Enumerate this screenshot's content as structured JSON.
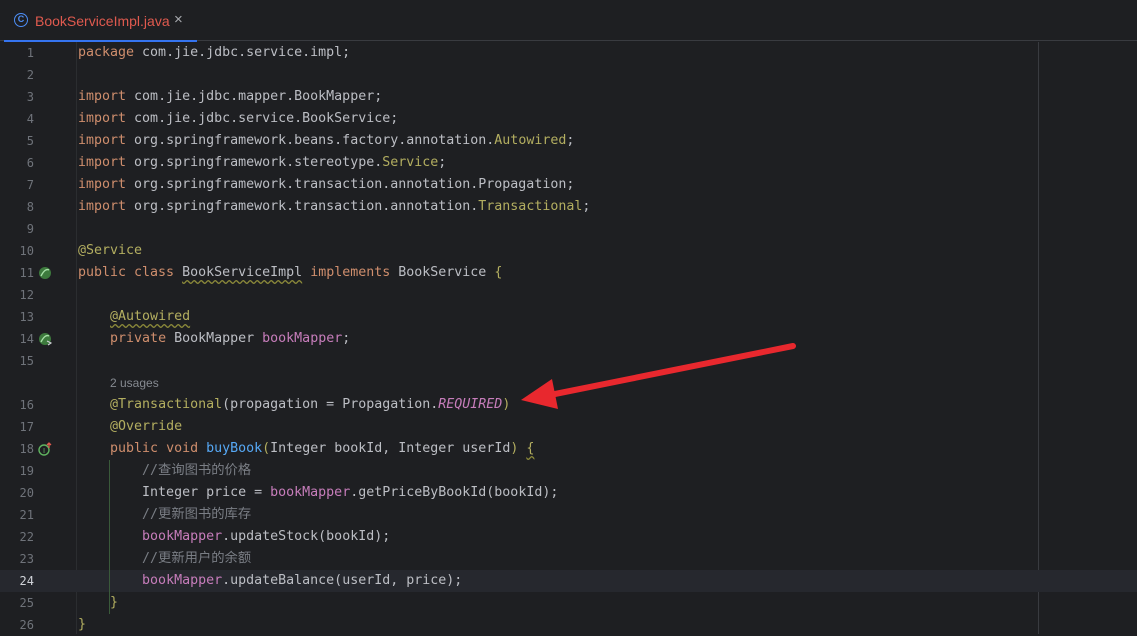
{
  "tab": {
    "icon": "class-c-icon",
    "label": "BookServiceImpl.java",
    "close": "×"
  },
  "editor": {
    "current_line": "24",
    "hint": "2 usages",
    "lines": [
      {
        "n": "1",
        "parts": [
          [
            "kw",
            "package"
          ],
          [
            "",
            "com.jie.jdbc.service.impl;"
          ]
        ]
      },
      {
        "n": "2",
        "parts": []
      },
      {
        "n": "3",
        "parts": [
          [
            "kw",
            "import"
          ],
          [
            "",
            "com.jie.jdbc.mapper.BookMapper;"
          ]
        ]
      },
      {
        "n": "4",
        "parts": [
          [
            "kw",
            "import"
          ],
          [
            "",
            "com.jie.jdbc.service.BookService;"
          ]
        ]
      },
      {
        "n": "5",
        "parts": [
          [
            "kw",
            "import"
          ],
          [
            "",
            "org.springframework.beans.factory.annotation."
          ],
          [
            "ann",
            "Autowired"
          ],
          [
            "",
            ";"
          ]
        ]
      },
      {
        "n": "6",
        "parts": [
          [
            "kw",
            "import"
          ],
          [
            "",
            "org.springframework.stereotype."
          ],
          [
            "ann",
            "Service"
          ],
          [
            "",
            ";"
          ]
        ]
      },
      {
        "n": "7",
        "parts": [
          [
            "kw",
            "import"
          ],
          [
            "",
            "org.springframework.transaction.annotation.Propagation;"
          ]
        ]
      },
      {
        "n": "8",
        "parts": [
          [
            "kw",
            "import"
          ],
          [
            "",
            "org.springframework.transaction.annotation."
          ],
          [
            "ann",
            "Transactional"
          ],
          [
            "",
            ";"
          ]
        ]
      },
      {
        "n": "9",
        "parts": []
      },
      {
        "n": "10",
        "parts": [
          [
            "ann",
            "@Service"
          ]
        ]
      },
      {
        "n": "11",
        "parts": [
          [
            "kw",
            "public class "
          ],
          [
            "wavy",
            "BookServiceImpl"
          ],
          [
            "",
            " "
          ],
          [
            "kw",
            "implements"
          ],
          [
            "",
            " BookService "
          ],
          [
            "ann",
            "{"
          ]
        ]
      },
      {
        "n": "12",
        "parts": []
      },
      {
        "n": "13",
        "parts": [
          [
            "",
            "    "
          ],
          [
            "ann wavy",
            "@Autowired"
          ]
        ]
      },
      {
        "n": "14",
        "parts": [
          [
            "",
            "    "
          ],
          [
            "kw",
            "private"
          ],
          [
            "",
            " BookMapper "
          ],
          [
            "fld",
            "bookMapper"
          ],
          [
            "",
            ";"
          ]
        ]
      },
      {
        "n": "15",
        "parts": []
      },
      {
        "n": "16",
        "parts": [
          [
            "",
            "    "
          ],
          [
            "ann",
            "@Transactional"
          ],
          [
            "",
            "(propagation = Propagation."
          ],
          [
            "const",
            "REQUIRED"
          ],
          [
            "ann",
            ")"
          ]
        ]
      },
      {
        "n": "17",
        "parts": [
          [
            "",
            "    "
          ],
          [
            "ann",
            "@Override"
          ]
        ]
      },
      {
        "n": "18",
        "parts": [
          [
            "",
            "    "
          ],
          [
            "kw",
            "public void "
          ],
          [
            "fn",
            "buyBook"
          ],
          [
            "ann",
            "("
          ],
          [
            "",
            "Integer bookId, Integer userId"
          ],
          [
            "ann",
            ")"
          ],
          [
            "",
            " "
          ],
          [
            "ann wavy",
            "{"
          ]
        ]
      },
      {
        "n": "19",
        "parts": [
          [
            "",
            "        "
          ],
          [
            "cmt",
            "//查询图书的价格"
          ]
        ]
      },
      {
        "n": "20",
        "parts": [
          [
            "",
            "        Integer price = "
          ],
          [
            "fld",
            "bookMapper"
          ],
          [
            "",
            ".getPriceByBookId(bookId);"
          ]
        ]
      },
      {
        "n": "21",
        "parts": [
          [
            "",
            "        "
          ],
          [
            "cmt",
            "//更新图书的库存"
          ]
        ]
      },
      {
        "n": "22",
        "parts": [
          [
            "",
            "        "
          ],
          [
            "fld",
            "bookMapper"
          ],
          [
            "",
            ".updateStock(bookId);"
          ]
        ]
      },
      {
        "n": "23",
        "parts": [
          [
            "",
            "        "
          ],
          [
            "cmt",
            "//更新用户的余额"
          ]
        ]
      },
      {
        "n": "24",
        "parts": [
          [
            "",
            "        "
          ],
          [
            "fld",
            "bookMapper"
          ],
          [
            "",
            ".updateBalance(userId, price);"
          ]
        ]
      },
      {
        "n": "25",
        "parts": [
          [
            "",
            "    "
          ],
          [
            "ann",
            "}"
          ]
        ]
      },
      {
        "n": "26",
        "parts": [
          [
            "ann",
            "}"
          ]
        ]
      }
    ],
    "gutter_icons": {
      "11": "bean-class-icon",
      "14": "bean-autowired-icon",
      "18": "implements-method-icon"
    }
  },
  "colors": {
    "background": "#1e1f22",
    "keyword": "#cf8e6d",
    "annotation": "#b3ae60",
    "method": "#56a8f5",
    "field": "#c77dbb",
    "comment": "#7a7e85",
    "text": "#bcbec4",
    "tab_accent": "#3574f0",
    "arrow": "#e8282e"
  }
}
